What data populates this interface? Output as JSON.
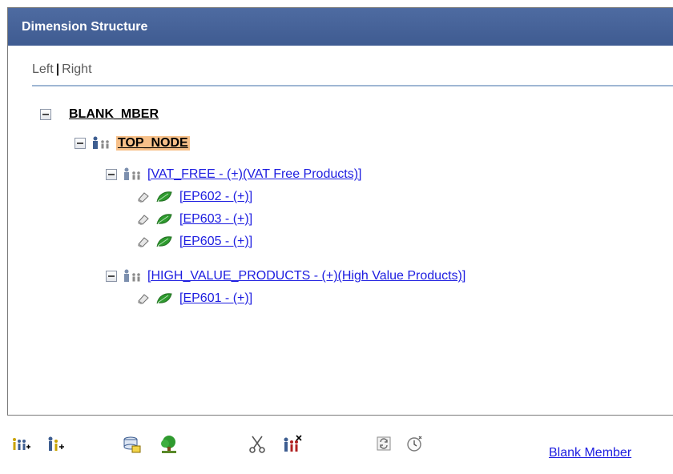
{
  "panel": {
    "title": "Dimension Structure",
    "left_label": "Left",
    "separator": "|",
    "right_label": "Right"
  },
  "tree": {
    "root": "BLANK_MBER",
    "top_node": "TOP_NODE",
    "groups": [
      {
        "label": "[VAT_FREE - (+)(VAT Free Products)]",
        "children": [
          "[EP602 - (+)]",
          "[EP603 - (+)]",
          "[EP605 - (+)]"
        ]
      },
      {
        "label": "[HIGH_VALUE_PRODUCTS - (+)(High Value Products)]",
        "children": [
          "[EP601 - (+)]"
        ]
      }
    ]
  },
  "toolbar": {
    "icons": [
      "insert-child-icon",
      "insert-sibling-icon",
      "node-detail-icon",
      "tree-icon",
      "cut-icon",
      "delete-node-icon",
      "refresh-icon",
      "history-icon"
    ],
    "blank_member_link": "Blank Member"
  },
  "colors": {
    "header_bg": "#4a66a0",
    "link": "#1d1de0",
    "highlight": "#f7c089",
    "leaf_green": "#2e9a2e"
  }
}
